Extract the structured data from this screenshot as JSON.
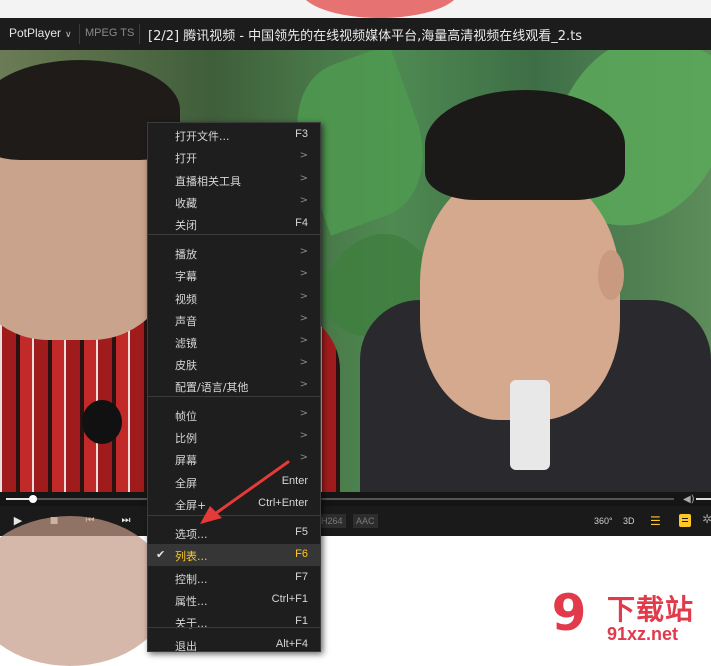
{
  "player": {
    "brand": "PotPlayer",
    "codec_badge": "MPEG TS",
    "window_title": "[2/2] 腾讯视频 - 中国领先的在线视频媒体平台,海量高清视频在线观看_2.ts",
    "progress": 0.04
  },
  "controls": {
    "play_icon": "▶",
    "stop_icon": "■",
    "prev_icon": "⏮",
    "next_icon": "⏭",
    "video_codec": "H264",
    "audio_codec": "AAC",
    "vr_label": "360°",
    "threeD_label": "3D"
  },
  "menu": {
    "items": [
      {
        "label": "打开文件...",
        "shortcut": "F3",
        "submenu": false
      },
      {
        "label": "打开",
        "shortcut": "",
        "submenu": true
      },
      {
        "label": "直播相关工具",
        "shortcut": "",
        "submenu": true
      },
      {
        "label": "收藏",
        "shortcut": "",
        "submenu": true
      },
      {
        "label": "关闭",
        "shortcut": "F4",
        "submenu": false
      },
      {
        "label": "播放",
        "shortcut": "",
        "submenu": true
      },
      {
        "label": "字幕",
        "shortcut": "",
        "submenu": true
      },
      {
        "label": "视频",
        "shortcut": "",
        "submenu": true
      },
      {
        "label": "声音",
        "shortcut": "",
        "submenu": true
      },
      {
        "label": "滤镜",
        "shortcut": "",
        "submenu": true
      },
      {
        "label": "皮肤",
        "shortcut": "",
        "submenu": true
      },
      {
        "label": "配置/语言/其他",
        "shortcut": "",
        "submenu": true
      },
      {
        "label": "帧位",
        "shortcut": "",
        "submenu": true
      },
      {
        "label": "比例",
        "shortcut": "",
        "submenu": true
      },
      {
        "label": "屏幕",
        "shortcut": "",
        "submenu": true
      },
      {
        "label": "全屏",
        "shortcut": "Enter",
        "submenu": false
      },
      {
        "label": "全屏+",
        "shortcut": "Ctrl+Enter",
        "submenu": false
      },
      {
        "label": "选项...",
        "shortcut": "F5",
        "submenu": false
      },
      {
        "label": "列表...",
        "shortcut": "F6",
        "submenu": false,
        "checked": true,
        "highlighted": true
      },
      {
        "label": "控制...",
        "shortcut": "F7",
        "submenu": false
      },
      {
        "label": "属性...",
        "shortcut": "Ctrl+F1",
        "submenu": false
      },
      {
        "label": "关于...",
        "shortcut": "F1",
        "submenu": false
      },
      {
        "label": "退出",
        "shortcut": "Alt+F4",
        "submenu": false
      }
    ],
    "submenu_arrow": ">"
  },
  "watermark": {
    "logo_text": "9",
    "title": "下载站",
    "domain": "91xz.net"
  },
  "colors": {
    "accent": "#ffc727",
    "annotation": "#e53a3a",
    "watermark": "#e03a4b"
  }
}
